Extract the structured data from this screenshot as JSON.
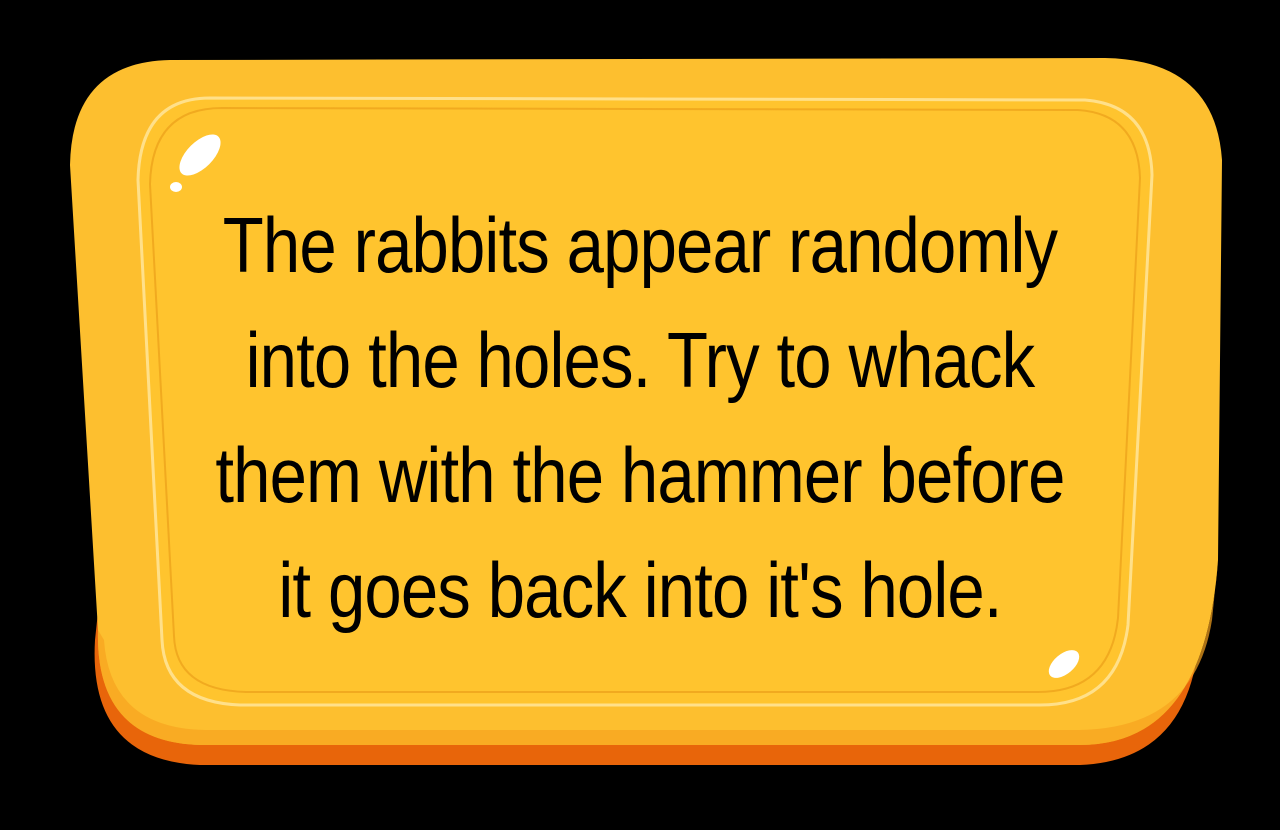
{
  "panel": {
    "message_lines": [
      "The rabbits appear randomly",
      "into the holes.  Try to whack",
      "them with the hammer before",
      "it goes back into it's hole."
    ],
    "colors": {
      "background": "#000000",
      "panel_face": "#FDBF2F",
      "panel_inner": "#FFC42E",
      "panel_shadow": "#E8650A",
      "panel_rim": "#F49C1B",
      "highlight": "#FFFFFF",
      "text": "#000000"
    }
  }
}
